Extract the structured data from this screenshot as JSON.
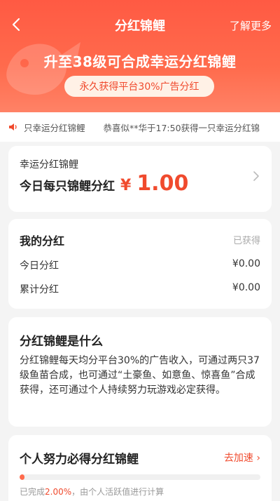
{
  "header": {
    "title": "分红锦鲤",
    "more_label": "了解更多",
    "headline": "升至38级可合成幸运分红锦鲤",
    "pill": "永久获得平台30%广告分红"
  },
  "ticker": {
    "items": [
      "只幸运分红锦鲤",
      "恭喜似**华于17:50获得一只幸运分红锦"
    ]
  },
  "lucky": {
    "label": "幸运分红锦鲤",
    "text": "今日每只锦鲤分红",
    "currency": "¥",
    "amount": "1.00"
  },
  "my_dividend": {
    "title": "我的分红",
    "obtained": "已获得",
    "rows": [
      {
        "label": "今日分红",
        "value": "¥0.00"
      },
      {
        "label": "累计分红",
        "value": "¥0.00"
      }
    ]
  },
  "what_is": {
    "title": "分红锦鲤是什么",
    "body": "分红锦鲤每天均分平台30%的广告收入，可通过两只37级鱼苗合成，也可通过“土豪鱼、如意鱼、惊喜鱼”合成获得，还可通过个人持续努力玩游戏必定获得。"
  },
  "effort": {
    "title": "个人努力必得分红锦鲤",
    "go_label": "去加速",
    "foot_prefix": "已完成",
    "percent": "2.00%",
    "foot_suffix": "，由个人活跃值进行计算",
    "progress_fraction": 0.02
  },
  "colors": {
    "accent": "#f04a2d",
    "hero": "#ff5a43"
  },
  "icons": {
    "back": "chevron-left-icon",
    "speaker": "speaker-icon",
    "chevron": "chevron-right-icon"
  }
}
